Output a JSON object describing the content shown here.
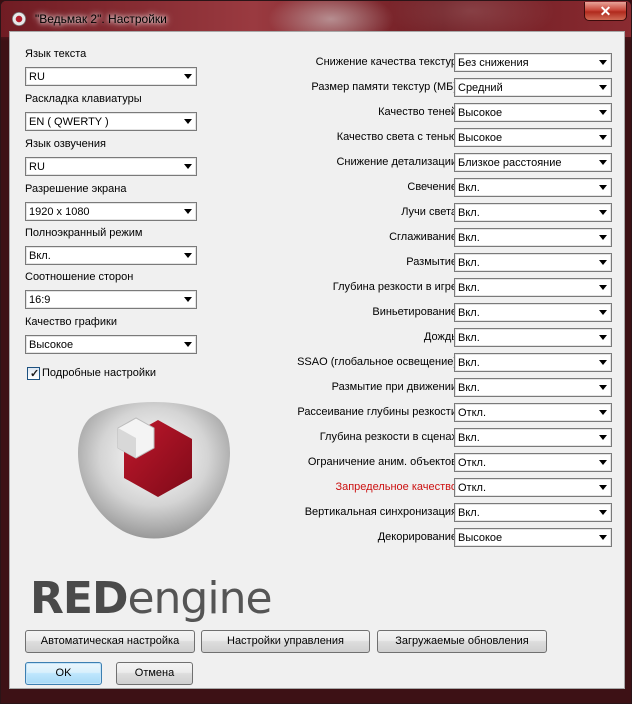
{
  "window": {
    "title": "\"Ведьмак 2\". Настройки",
    "close_glyph": "✕"
  },
  "left": {
    "fields": [
      {
        "label": "Язык текста",
        "value": "RU"
      },
      {
        "label": "Раскладка клавиатуры",
        "value": "EN ( QWERTY )"
      },
      {
        "label": "Язык озвучения",
        "value": "RU"
      },
      {
        "label": "Разрешение экрана",
        "value": "1920 x 1080"
      },
      {
        "label": "Полноэкранный режим",
        "value": "Вкл."
      },
      {
        "label": "Соотношение сторон",
        "value": "16:9"
      },
      {
        "label": "Качество графики",
        "value": "Высокое"
      }
    ],
    "advanced_checkbox": {
      "label": "Подробные настройки",
      "checked": true,
      "tick": "✓"
    }
  },
  "right": {
    "settings": [
      {
        "label": "Снижение качества текстур",
        "value": "Без снижения"
      },
      {
        "label": "Размер памяти текстур (МБ)",
        "value": "Средний"
      },
      {
        "label": "Качество теней",
        "value": "Высокое"
      },
      {
        "label": "Качество света с тенью",
        "value": "Высокое"
      },
      {
        "label": "Снижение детализации",
        "value": "Близкое расстояние"
      },
      {
        "label": "Свечение",
        "value": "Вкл."
      },
      {
        "label": "Лучи света",
        "value": "Вкл."
      },
      {
        "label": "Сглаживание",
        "value": "Вкл."
      },
      {
        "label": "Размытие",
        "value": "Вкл."
      },
      {
        "label": "Глубина резкости в игре",
        "value": "Вкл."
      },
      {
        "label": "Виньетирование",
        "value": "Вкл."
      },
      {
        "label": "Дождь",
        "value": "Вкл."
      },
      {
        "label": "SSAO (глобальное освещение)",
        "value": "Вкл."
      },
      {
        "label": "Размытие при движении",
        "value": "Вкл."
      },
      {
        "label": "Рассеивание глубины резкости",
        "value": "Откл."
      },
      {
        "label": "Глубина резкости в сценах",
        "value": "Вкл."
      },
      {
        "label": "Ограничение аним. объектов",
        "value": "Откл."
      },
      {
        "label": "Запредельное качество",
        "value": "Откл."
      },
      {
        "label": "Вертикальная синхронизация",
        "value": "Вкл."
      },
      {
        "label": "Декорирование",
        "value": "Высокое"
      }
    ],
    "highlight_color": "#cc1111"
  },
  "branding": {
    "red": "RED",
    "engine": "engine"
  },
  "buttons": {
    "auto": "Автоматическая настройка",
    "controls": "Настройки управления",
    "updates": "Загружаемые обновления",
    "ok": "OK",
    "cancel": "Отмена"
  }
}
